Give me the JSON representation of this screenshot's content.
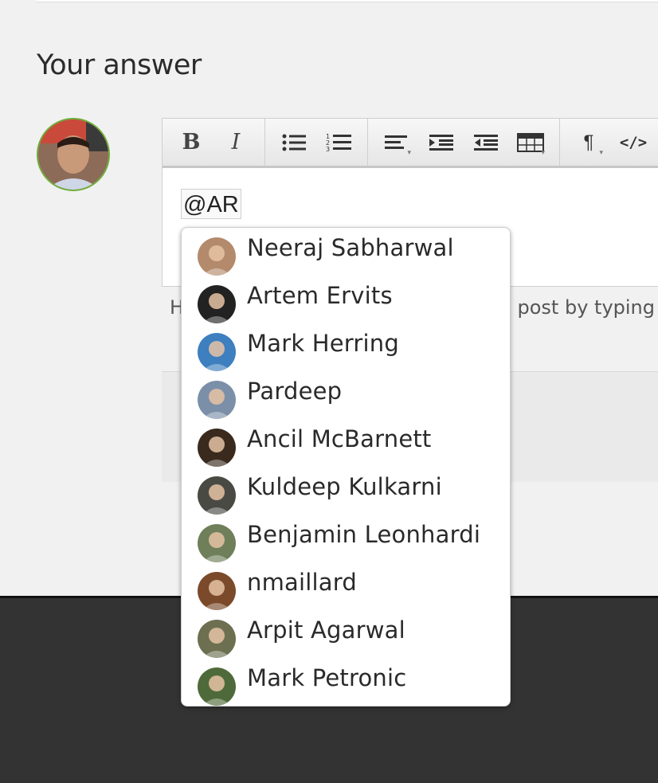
{
  "section": {
    "title": "Your answer"
  },
  "user": {
    "avatar_icon": "user-avatar"
  },
  "editor": {
    "toolbar": [
      {
        "name": "bold-button",
        "icon": "bold-icon",
        "glyph": "B"
      },
      {
        "name": "italic-button",
        "icon": "italic-icon",
        "glyph": "I"
      },
      {
        "name": "bullet-list-button",
        "icon": "bullet-list-icon"
      },
      {
        "name": "numbered-list-button",
        "icon": "numbered-list-icon"
      },
      {
        "name": "align-button",
        "icon": "align-left-icon"
      },
      {
        "name": "indent-button",
        "icon": "indent-icon"
      },
      {
        "name": "outdent-button",
        "icon": "outdent-icon"
      },
      {
        "name": "table-button",
        "icon": "table-icon"
      },
      {
        "name": "paragraph-button",
        "icon": "paragraph-icon",
        "glyph": "¶"
      },
      {
        "name": "code-button",
        "icon": "code-icon",
        "glyph": "</>"
      }
    ],
    "content": "@AR"
  },
  "help": {
    "left": "H",
    "right": "s post by typing"
  },
  "mentions": [
    {
      "name": "Neeraj Sabharwal",
      "avatar_color": "#b48a6c"
    },
    {
      "name": "Artem Ervits",
      "avatar_color": "#222222"
    },
    {
      "name": "Mark Herring",
      "avatar_color": "#3d7fbf"
    },
    {
      "name": "Pardeep",
      "avatar_color": "#7b8fa8"
    },
    {
      "name": "Ancil McBarnett",
      "avatar_color": "#3a2a1e"
    },
    {
      "name": "Kuldeep Kulkarni",
      "avatar_color": "#4a4a44"
    },
    {
      "name": "Benjamin Leonhardi",
      "avatar_color": "#6e7f5a"
    },
    {
      "name": "nmaillard",
      "avatar_color": "#7a4a2a"
    },
    {
      "name": "Arpit Agarwal",
      "avatar_color": "#6c7050"
    },
    {
      "name": "Mark Petronic",
      "avatar_color": "#4f6a3a"
    }
  ],
  "colors": {
    "accent_ring": "#6fae3a",
    "footer": "#333333"
  }
}
